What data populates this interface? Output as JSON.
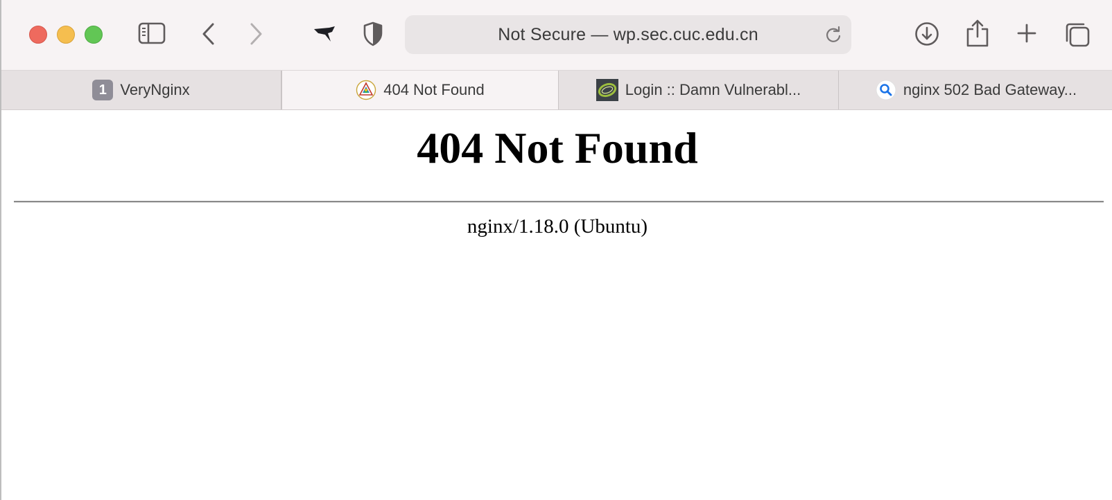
{
  "toolbar": {
    "url_text": "Not Secure — wp.sec.cuc.edu.cn",
    "icons": {
      "sidebar": "sidebar-icon",
      "back": "chevron-left-icon",
      "forward": "chevron-right-icon",
      "extension": "bird-extension-icon",
      "privacy": "shield-icon",
      "reload": "reload-icon",
      "downloads": "download-icon",
      "share": "share-icon",
      "new_tab": "plus-icon",
      "tab_overview": "tab-overview-icon"
    }
  },
  "tabs": [
    {
      "label": "VeryNginx",
      "badge": "1",
      "active": false
    },
    {
      "label": "404 Not Found",
      "active": true
    },
    {
      "label": "Login :: Damn Vulnerabl...",
      "active": false
    },
    {
      "label": "nginx 502 Bad Gateway...",
      "active": false
    }
  ],
  "page": {
    "heading": "404 Not Found",
    "server": "nginx/1.18.0 (Ubuntu)"
  },
  "colors": {
    "close": "#ee6a5e",
    "minimize": "#f5be4f",
    "zoom": "#62c655"
  }
}
